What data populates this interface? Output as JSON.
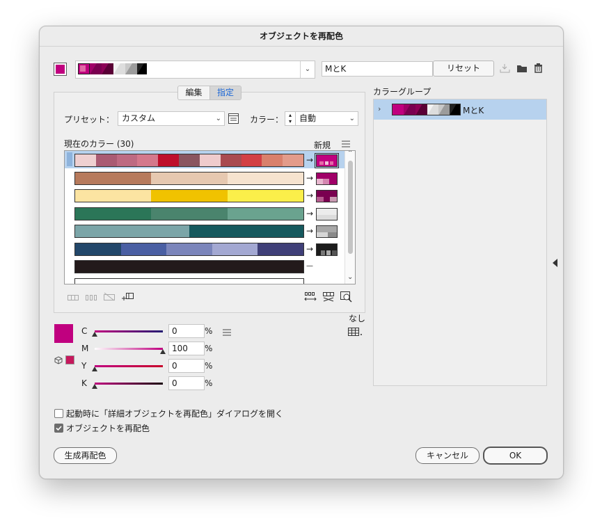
{
  "dialog": {
    "title": "オブジェクトを再配色",
    "harmony_name": "MとK",
    "reset_label": "リセット",
    "tabs": [
      {
        "label": "編集"
      },
      {
        "label": "指定"
      }
    ],
    "preset_label": "プリセット：",
    "preset_value": "カスタム",
    "color_label": "カラー：",
    "color_value": "自動",
    "current_colors_label": "現在のカラー (30)",
    "new_label": "新規",
    "color_groups_label": "カラーグループ",
    "color_group_item": "MとK",
    "none_label": "なし",
    "sliders": [
      {
        "label": "C",
        "value": "0",
        "unit": "%",
        "level": 0
      },
      {
        "label": "M",
        "value": "100",
        "unit": "%",
        "level": 100
      },
      {
        "label": "Y",
        "value": "0",
        "unit": "%",
        "level": 0
      },
      {
        "label": "K",
        "value": "0",
        "unit": "%",
        "level": 0
      }
    ],
    "options": [
      {
        "label": "起動時に「詳細オブジェクトを再配色」ダイアログを開く",
        "checked": false
      },
      {
        "label": "オブジェクトを再配色",
        "checked": true
      }
    ],
    "generate_label": "生成再配色",
    "cancel_label": "キャンセル",
    "ok_label": "OK"
  },
  "colors": {
    "magenta": "#c0007f",
    "selection": "#b7d2ee",
    "ok_border": "#555555"
  },
  "color_rows": [
    {
      "current": [
        "#efd0d1",
        "#aa5b73",
        "#be6a82",
        "#d4788c",
        "#be0f2c",
        "#8a5560",
        "#efcbcc",
        "#a94a50",
        "#d24045",
        "#d9806c",
        "#e39b8a"
      ],
      "new": "magenta-tint",
      "selected": true
    },
    {
      "current": [
        "#b77a5c",
        "#e6c8b0",
        "#f6e3cf"
      ],
      "new": "magenta-mid"
    },
    {
      "current": [
        "#fce4a2",
        "#f0c200",
        "#fbef4a"
      ],
      "new": "magenta-dark"
    },
    {
      "current": [
        "#2b7658",
        "#4a846d",
        "#6aa38f"
      ],
      "new": "grey-light"
    },
    {
      "current": [
        "#7ba5a8",
        "#16595e"
      ],
      "new": "grey-mid"
    },
    {
      "current": [
        "#22476a",
        "#4a5fa3",
        "#7b85bb",
        "#a3a8d2",
        "#3f3f78"
      ],
      "new": "black"
    },
    {
      "current": [
        "#231a1b"
      ],
      "new": "none"
    }
  ],
  "icons": [
    "dropdown-chevron-icon",
    "save-group-icon",
    "folder-icon",
    "trash-icon",
    "preset-menu-icon",
    "list-menu-icon",
    "merge-colors-icon",
    "separate-colors-icon",
    "exclude-colors-icon",
    "new-row-icon",
    "random-order-icon",
    "random-saturation-icon",
    "find-color-icon",
    "expand-arrow-icon",
    "collapse-panel-icon",
    "cmyk-3d-icon",
    "swatch-limit-icon"
  ]
}
